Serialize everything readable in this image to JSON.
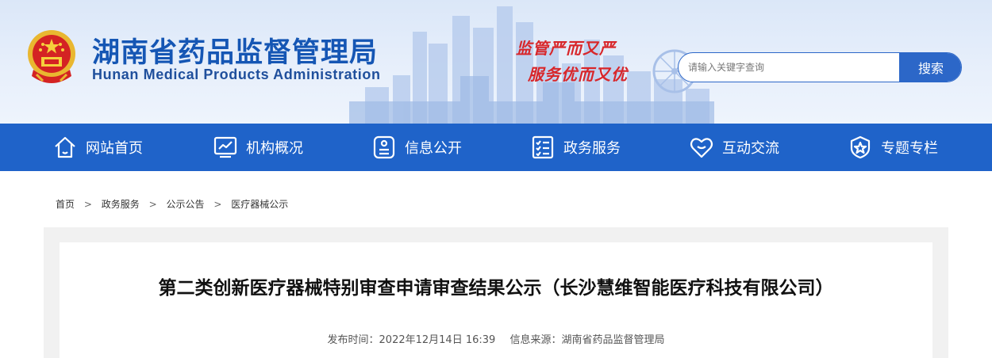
{
  "header": {
    "site_title": "湖南省药品监督管理局",
    "site_subtitle": "Hunan Medical Products Administration",
    "slogan_line1": "监管严而又严",
    "slogan_line2": "服务优而又优",
    "emblem_icon": "national-emblem-icon"
  },
  "search": {
    "placeholder": "请输入关键字查询",
    "button_label": "搜索"
  },
  "nav": {
    "items": [
      {
        "label": "网站首页",
        "icon": "home-icon"
      },
      {
        "label": "机构概况",
        "icon": "chart-monitor-icon"
      },
      {
        "label": "信息公开",
        "icon": "info-card-icon"
      },
      {
        "label": "政务服务",
        "icon": "checklist-icon"
      },
      {
        "label": "互动交流",
        "icon": "heart-hands-icon"
      },
      {
        "label": "专题专栏",
        "icon": "star-shield-icon"
      }
    ]
  },
  "breadcrumb": {
    "items": [
      "首页",
      "政务服务",
      "公示公告",
      "医疗器械公示"
    ],
    "separator": ">"
  },
  "article": {
    "title": "第二类创新医疗器械特别审查申请审查结果公示（长沙慧维智能医疗科技有限公司）",
    "publish_time": "发布时间：2022年12月14日 16:39",
    "source": "信息来源：湖南省药品监督管理局"
  },
  "colors": {
    "brand_blue": "#1f63c9",
    "title_blue": "#1556b4",
    "slogan_red": "#d8262a",
    "content_bg": "#f1f1f1"
  }
}
